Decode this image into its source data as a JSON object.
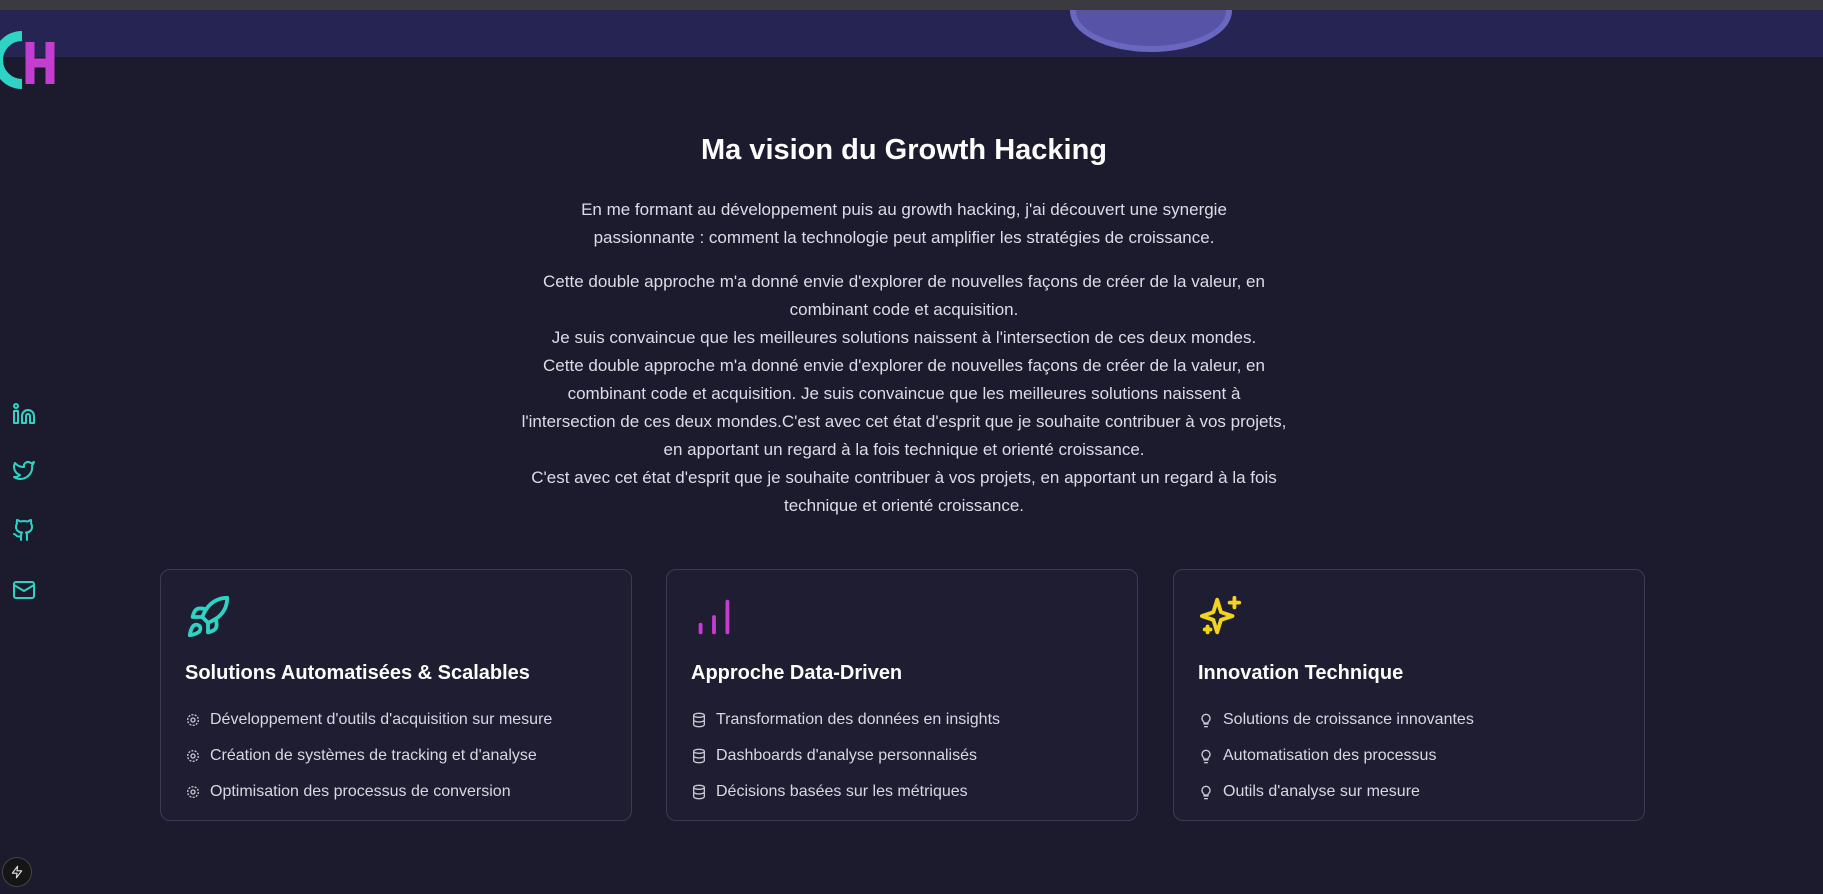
{
  "logo": {
    "icon": "gh-logo"
  },
  "social_links": [
    {
      "name": "linkedin-icon"
    },
    {
      "name": "twitter-icon"
    },
    {
      "name": "github-icon"
    },
    {
      "name": "mail-icon"
    }
  ],
  "vision": {
    "title": "Ma vision du Growth Hacking",
    "intro": "En me formant au développement puis au growth hacking, j'ai découvert une synergie passionnante : comment la technologie peut amplifier les stratégies de croissance.",
    "paragraphs": [
      "Cette double approche m'a donné envie d'explorer de nouvelles façons de créer de la valeur, en combinant code et acquisition.",
      "Je suis convaincue que les meilleures solutions naissent à l'intersection de ces deux mondes.",
      "Cette double approche m'a donné envie d'explorer de nouvelles façons de créer de la valeur, en combinant code et acquisition. Je suis convaincue que les meilleures solutions naissent à l'intersection de ces deux mondes.C'est avec cet état d'esprit que je souhaite contribuer à vos projets, en apportant un regard à la fois technique et orienté croissance.",
      "C'est avec cet état d'esprit que je souhaite contribuer à vos projets, en apportant un regard à la fois technique et orienté croissance."
    ]
  },
  "cards": [
    {
      "icon": "rocket-icon",
      "color": "#2fd3c4",
      "title": "Solutions Automatisées & Scalables",
      "item_icon": "gear-icon",
      "items": [
        "Développement d'outils d'acquisition sur mesure",
        "Création de systèmes de tracking et d'analyse",
        "Optimisation des processus de conversion"
      ]
    },
    {
      "icon": "bar-chart-icon",
      "color": "#c23dd0",
      "title": "Approche Data-Driven",
      "item_icon": "database-icon",
      "items": [
        "Transformation des données en insights",
        "Dashboards d'analyse personnalisés",
        "Décisions basées sur les métriques"
      ]
    },
    {
      "icon": "sparkles-icon",
      "color": "#f2d51a",
      "title": "Innovation Technique",
      "item_icon": "lightbulb-icon",
      "items": [
        "Solutions de croissance innovantes",
        "Automatisation des processus",
        "Outils d'analyse sur mesure"
      ]
    }
  ],
  "colors": {
    "background": "#1c1b2e",
    "accent": "#2fd3c4"
  },
  "dev_badge": {
    "icon": "lightning-icon"
  }
}
